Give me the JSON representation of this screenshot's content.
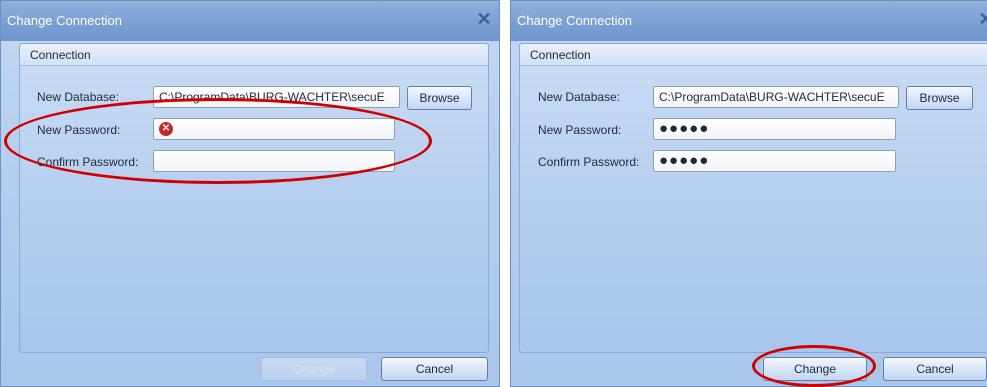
{
  "left": {
    "title": "Change Connection",
    "close_glyph": "✕",
    "group_title": "Connection",
    "new_database_label": "New Database:",
    "new_database_value": "C:\\ProgramData\\BURG-WACHTER\\secuE",
    "browse_label": "Browse",
    "new_password_label": "New Password:",
    "new_password_value": "",
    "confirm_password_label": "Confirm Password:",
    "confirm_password_value": "",
    "change_label": "Change",
    "cancel_label": "Cancel",
    "error_glyph": "✕"
  },
  "right": {
    "title": "Change Connection",
    "close_glyph": "✕",
    "group_title": "Connection",
    "new_database_label": "New Database:",
    "new_database_value": "C:\\ProgramData\\BURG-WACHTER\\secuE",
    "browse_label": "Browse",
    "new_password_label": "New Password:",
    "new_password_value": "●●●●●",
    "confirm_password_label": "Confirm Password:",
    "confirm_password_value": "●●●●●",
    "change_label": "Change",
    "cancel_label": "Cancel"
  },
  "colors": {
    "annotation": "#d00000",
    "titlebar": "#7aa0d3",
    "dialog_background": "#b6cfee"
  },
  "icons": {
    "close": "close-icon",
    "error": "error-icon"
  }
}
